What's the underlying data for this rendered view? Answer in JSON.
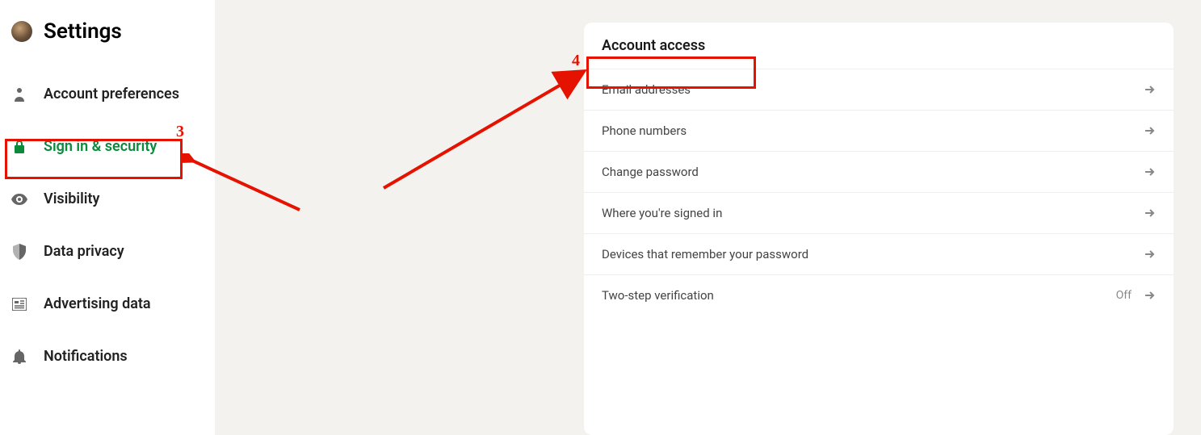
{
  "page_title": "Settings",
  "sidebar": {
    "items": [
      {
        "label": "Account preferences",
        "icon": "person-icon"
      },
      {
        "label": "Sign in & security",
        "icon": "lock-icon",
        "active": true
      },
      {
        "label": "Visibility",
        "icon": "eye-icon"
      },
      {
        "label": "Data privacy",
        "icon": "shield-icon"
      },
      {
        "label": "Advertising data",
        "icon": "newspaper-icon"
      },
      {
        "label": "Notifications",
        "icon": "bell-icon"
      }
    ]
  },
  "card": {
    "title": "Account access",
    "rows": [
      {
        "label": "Email addresses",
        "status": ""
      },
      {
        "label": "Phone numbers",
        "status": ""
      },
      {
        "label": "Change password",
        "status": ""
      },
      {
        "label": "Where you're signed in",
        "status": ""
      },
      {
        "label": "Devices that remember your password",
        "status": ""
      },
      {
        "label": "Two-step verification",
        "status": "Off"
      }
    ]
  },
  "annotations": {
    "num3": "3",
    "num4": "4"
  }
}
